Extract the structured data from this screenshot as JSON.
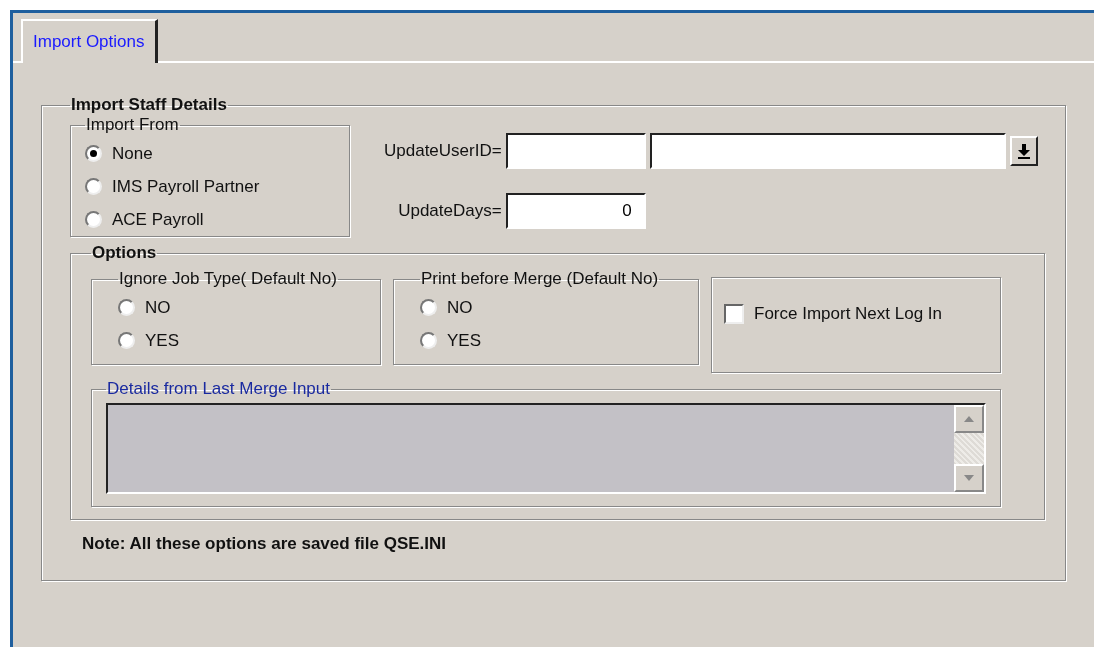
{
  "tabs": [
    {
      "label": "Import Options",
      "selected": true
    }
  ],
  "staff_group": {
    "title": "Import Staff Details",
    "import_from": {
      "title": "Import From",
      "options": [
        {
          "label": "None",
          "selected": true
        },
        {
          "label": "IMS Payroll Partner",
          "selected": false
        },
        {
          "label": "ACE Payroll",
          "selected": false
        }
      ]
    },
    "update_user_id": {
      "label": "UpdateUserID="
    },
    "update_days": {
      "label": "UpdateDays=",
      "value": "0"
    },
    "options": {
      "title": "Options",
      "ignore_job_type": {
        "title": "Ignore Job Type( Default No)",
        "options": [
          {
            "label": "NO",
            "selected": false
          },
          {
            "label": "YES",
            "selected": false
          }
        ]
      },
      "print_before_merge": {
        "title": "Print before Merge (Default No)",
        "options": [
          {
            "label": "NO",
            "selected": false
          },
          {
            "label": "YES",
            "selected": false
          }
        ]
      },
      "force_import": {
        "label": "Force Import Next Log In",
        "checked": false
      },
      "details": {
        "title": "Details from Last Merge Input"
      }
    }
  },
  "note": "Note: All these options are saved file QSE.INI"
}
